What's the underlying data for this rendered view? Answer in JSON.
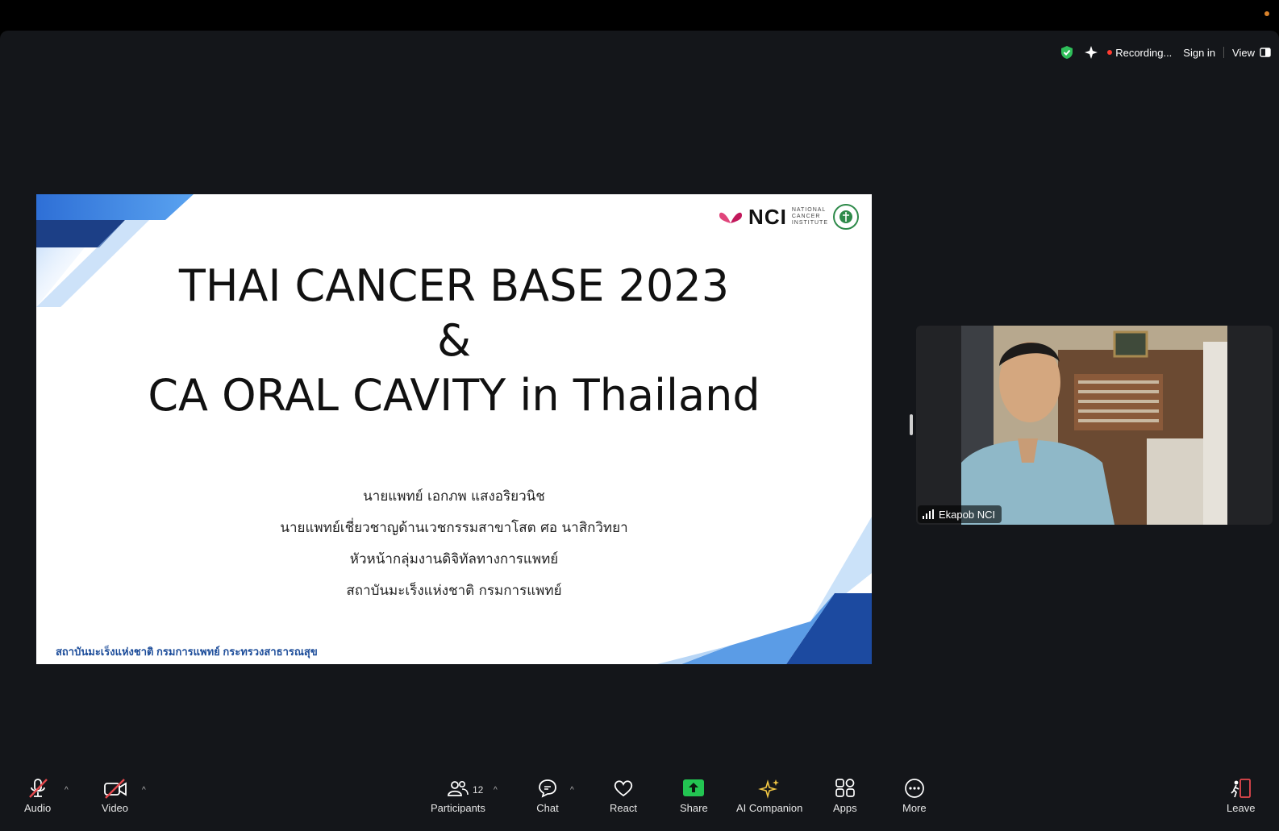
{
  "header": {
    "recording_label": "Recording...",
    "sign_in_label": "Sign in",
    "view_label": "View",
    "icons": [
      "shield-check-icon",
      "sparkle-icon",
      "recording-dot-icon",
      "view-layout-icon"
    ]
  },
  "slide": {
    "title_line1": "THAI CANCER BASE 2023",
    "title_line2": "&",
    "title_line3": "CA ORAL CAVITY in Thailand",
    "presenter_name": "นายแพทย์ เอกภพ แสงอริยวนิช",
    "presenter_role1": "นายแพทย์เชี่ยวชาญด้านเวชกรรมสาขาโสต ศอ นาสิกวิทยา",
    "presenter_role2": "หัวหน้ากลุ่มงานดิจิทัลทางการแพทย์",
    "presenter_org": "สถาบันมะเร็งแห่งชาติ กรมการแพทย์",
    "footer": "สถาบันมะเร็งแห่งชาติ กรมการแพทย์ กระทรวงสาธารณสุข",
    "logo_text": "NCI",
    "logo_small_line1": "NATIONAL",
    "logo_small_line2": "CANCER",
    "logo_small_line3": "INSTITUTE",
    "accent_color": "#1d4d9a"
  },
  "video": {
    "participant_name": "Ekapob NCI"
  },
  "toolbar": {
    "audio_label": "Audio",
    "video_label": "Video",
    "participants_label": "Participants",
    "participants_count": "12",
    "chat_label": "Chat",
    "react_label": "React",
    "share_label": "Share",
    "ai_label": "AI Companion",
    "apps_label": "Apps",
    "more_label": "More",
    "leave_label": "Leave",
    "share_color": "#23c552",
    "leave_color": "#e5484d",
    "muted_color": "#e5484d"
  }
}
